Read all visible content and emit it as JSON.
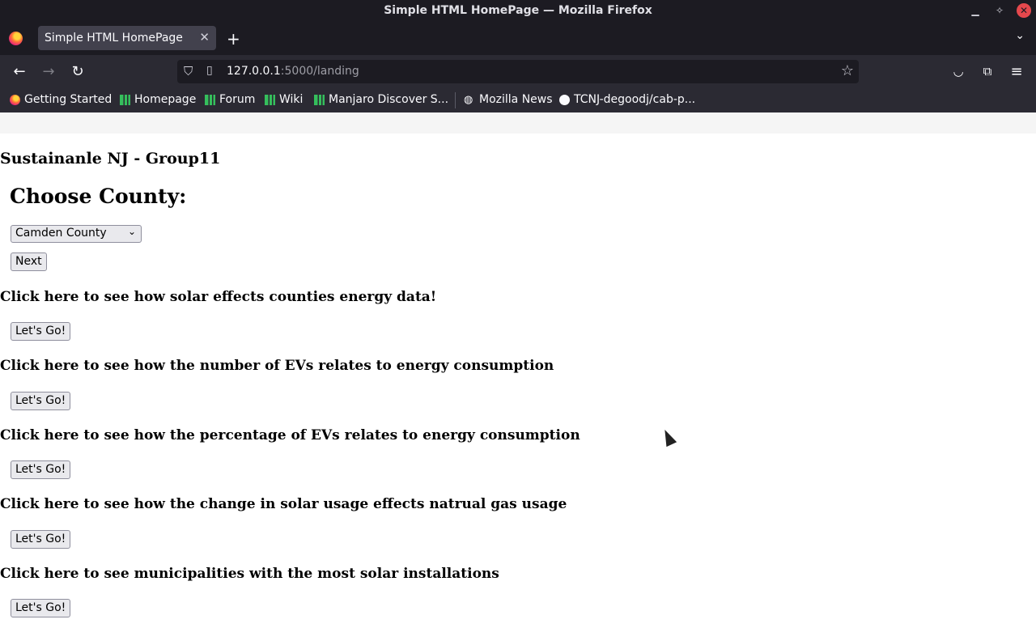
{
  "window": {
    "title": "Simple HTML HomePage — Mozilla Firefox"
  },
  "tabs": [
    {
      "label": "Simple HTML HomePage"
    }
  ],
  "urlbar": {
    "host": "127.0.0.1",
    "rest": ":5000/landing"
  },
  "bookmarks": [
    {
      "label": "Getting Started",
      "icon": "firefox-icon"
    },
    {
      "label": "Homepage",
      "icon": "manjaro-icon"
    },
    {
      "label": "Forum",
      "icon": "manjaro-icon"
    },
    {
      "label": "Wiki",
      "icon": "manjaro-icon"
    },
    {
      "label": "Manjaro Discover S...",
      "icon": "manjaro-icon"
    },
    {
      "label": "Mozilla News",
      "icon": "globe-icon"
    },
    {
      "label": "TCNJ-degoodj/cab-p...",
      "icon": "github-icon"
    }
  ],
  "page": {
    "site_title": "Sustainanle NJ - Group11",
    "choose_heading": "Choose County:",
    "county_selected": "Camden County",
    "next_label": "Next",
    "sections": [
      {
        "label": "Click here to see how solar effects counties energy data!",
        "button": "Let's Go!"
      },
      {
        "label": "Click here to see how the number of EVs relates to energy consumption",
        "button": "Let's Go!"
      },
      {
        "label": "Click here to see how the percentage of EVs relates to energy consumption",
        "button": "Let's Go!"
      },
      {
        "label": "Click here to see how the change in solar usage effects natrual gas usage",
        "button": "Let's Go!"
      },
      {
        "label": "Click here to see municipalities with the most solar installations",
        "button": "Let's Go!"
      }
    ]
  }
}
